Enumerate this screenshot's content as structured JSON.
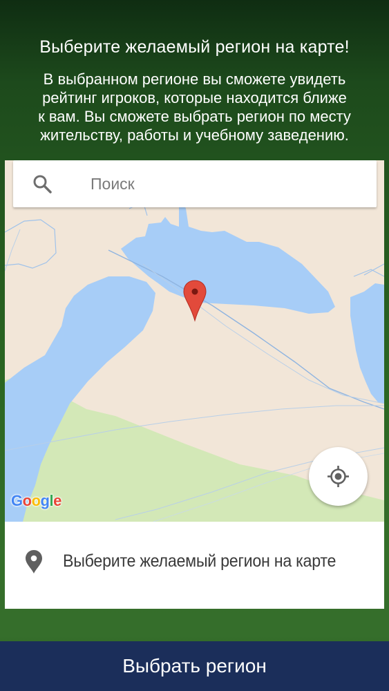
{
  "header": {
    "title": "Выберите желаемый регион на карте!",
    "description_lines": [
      "В выбранном регионе вы сможете увидеть",
      "рейтинг игроков, которые находится ближе",
      "к вам. Вы сможете выбрать регион по месту",
      "жительству, работы и учебному заведению."
    ]
  },
  "map": {
    "search": {
      "icon": "search-icon",
      "placeholder": "Поиск"
    },
    "logo": {
      "letters": [
        "G",
        "o",
        "o",
        "g",
        "l",
        "e"
      ],
      "colors": [
        "#4285F4",
        "#EA4335",
        "#FBBC05",
        "#4285F4",
        "#34A853",
        "#EA4335"
      ]
    },
    "locate_icon": "my-location-icon",
    "pin_icon": "map-marker-icon",
    "colors": {
      "land": "#f2e6d8",
      "water": "#a7cdf7",
      "park": "#d3e8b7",
      "road": "#8fb4e0",
      "pin": "#e24a3b"
    }
  },
  "location_panel": {
    "icon": "place-icon",
    "text": "Выберите желаемый регион на карте"
  },
  "footer": {
    "button_label": "Выбрать регион",
    "button_color": "#1b2e5a"
  }
}
